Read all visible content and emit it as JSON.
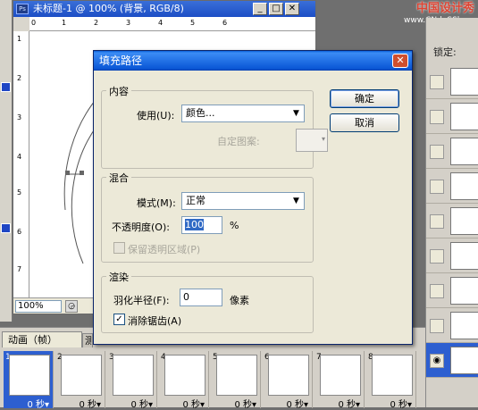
{
  "document": {
    "title": "未标题-1 @ 100% (背景, RGB/8)",
    "ps_badge": "Ps",
    "zoom": "100%",
    "ruler_top": [
      "0",
      "1",
      "2",
      "3",
      "4",
      "5",
      "6"
    ],
    "ruler_left": [
      "1",
      "2",
      "3",
      "4",
      "5",
      "6",
      "7"
    ]
  },
  "watermark": {
    "line1": "中国设计秀",
    "line2": "www.CNdeSShow.com"
  },
  "layers_panel": {
    "lock_label": "锁定:"
  },
  "animation_panel": {
    "tab_label": "动画（帧）",
    "tab2_label": "测",
    "frames": [
      {
        "num": "1",
        "duration": "0 秒▾"
      },
      {
        "num": "2",
        "duration": "0 秒▾"
      },
      {
        "num": "3",
        "duration": "0 秒▾"
      },
      {
        "num": "4",
        "duration": "0 秒▾"
      },
      {
        "num": "5",
        "duration": "0 秒▾"
      },
      {
        "num": "6",
        "duration": "0 秒▾"
      },
      {
        "num": "7",
        "duration": "0 秒▾"
      },
      {
        "num": "8",
        "duration": "0 秒▾"
      }
    ]
  },
  "dialog": {
    "title": "填充路径",
    "close_glyph": "✕",
    "ok_label": "确定",
    "cancel_label": "取消",
    "content_group": {
      "label": "内容",
      "use_label": "使用(U):",
      "use_value": "颜色...",
      "pattern_label": "自定图案:"
    },
    "blend_group": {
      "label": "混合",
      "mode_label": "模式(M):",
      "mode_value": "正常",
      "opacity_label": "不透明度(O):",
      "opacity_value": "100",
      "opacity_unit": "%",
      "preserve_label": "保留透明区域(P)"
    },
    "render_group": {
      "label": "渲染",
      "feather_label": "羽化半径(F):",
      "feather_value": "0",
      "feather_unit": "像素",
      "antialias_label": "消除锯齿(A)",
      "antialias_checked": "✓"
    }
  }
}
